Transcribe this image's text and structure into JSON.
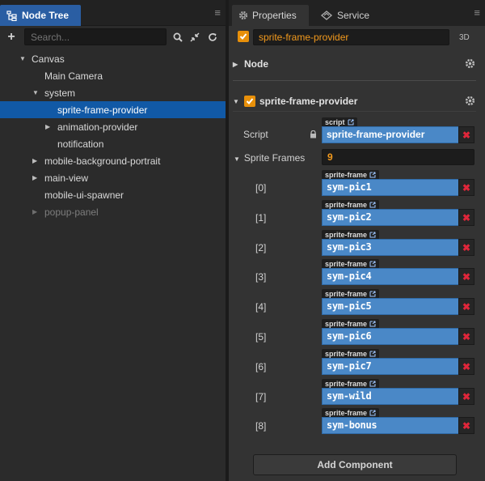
{
  "node_tree": {
    "tab_label": "Node Tree",
    "search_placeholder": "Search...",
    "items": [
      {
        "label": "Canvas",
        "expanded": true
      },
      {
        "label": "Main Camera"
      },
      {
        "label": "system",
        "expanded": true
      },
      {
        "label": "sprite-frame-provider",
        "selected": true
      },
      {
        "label": "animation-provider",
        "collapsed": true
      },
      {
        "label": "notification"
      },
      {
        "label": "mobile-background-portrait",
        "collapsed": true
      },
      {
        "label": "main-view",
        "collapsed": true
      },
      {
        "label": "mobile-ui-spawner"
      },
      {
        "label": "popup-panel",
        "collapsed": true,
        "inactive": true
      }
    ]
  },
  "inspector": {
    "tabs": [
      "Properties",
      "Service"
    ],
    "node_name": "sprite-frame-provider",
    "mode_label": "3D",
    "node_section": "Node",
    "component": {
      "title": "sprite-frame-provider",
      "script_label": "Script",
      "script_tag": "script",
      "script_value": "sprite-frame-provider",
      "frames_label": "Sprite Frames",
      "frames_count": "9",
      "frame_tag": "sprite-frame",
      "frames": [
        {
          "index": "[0]",
          "value": "sym-pic1"
        },
        {
          "index": "[1]",
          "value": "sym-pic2"
        },
        {
          "index": "[2]",
          "value": "sym-pic3"
        },
        {
          "index": "[3]",
          "value": "sym-pic4"
        },
        {
          "index": "[4]",
          "value": "sym-pic5"
        },
        {
          "index": "[5]",
          "value": "sym-pic6"
        },
        {
          "index": "[6]",
          "value": "sym-pic7"
        },
        {
          "index": "[7]",
          "value": "sym-wild"
        },
        {
          "index": "[8]",
          "value": "sym-bonus"
        }
      ]
    },
    "add_component": "Add Component"
  },
  "colors": {
    "accent_orange": "#f39a1d",
    "selection_blue": "#1159a6",
    "ref_blue": "#4a88c7",
    "remove_red": "#e0263a"
  }
}
